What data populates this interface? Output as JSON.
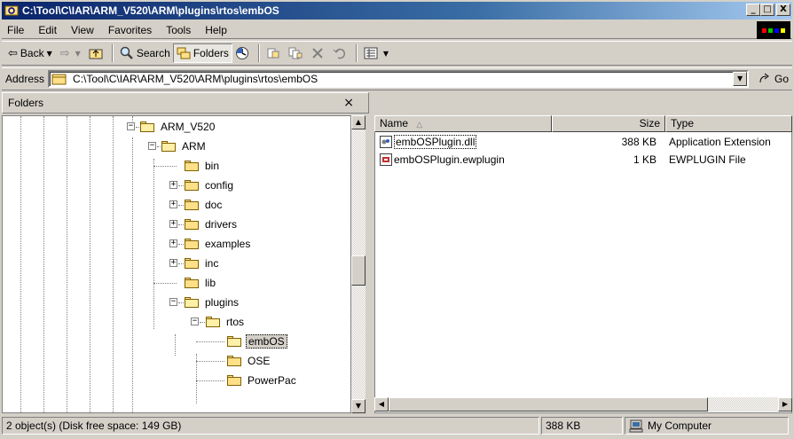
{
  "window": {
    "title": "C:\\Tool\\C\\IAR\\ARM_V520\\ARM\\plugins\\rtos\\embOS",
    "minimize": "_",
    "maximize": "□",
    "close": "X"
  },
  "menu": [
    "File",
    "Edit",
    "View",
    "Favorites",
    "Tools",
    "Help"
  ],
  "toolbar": {
    "back": "Back",
    "search": "Search",
    "folders": "Folders"
  },
  "address": {
    "label": "Address",
    "value": "C:\\Tool\\C\\IAR\\ARM_V520\\ARM\\plugins\\rtos\\embOS",
    "go": "Go"
  },
  "folders_pane": {
    "title": "Folders",
    "close": "×",
    "items": [
      {
        "label": "ARM_V520",
        "expander": "−"
      },
      {
        "label": "ARM",
        "expander": "−"
      },
      {
        "label": "bin",
        "expander": ""
      },
      {
        "label": "config",
        "expander": "+"
      },
      {
        "label": "doc",
        "expander": "+"
      },
      {
        "label": "drivers",
        "expander": "+"
      },
      {
        "label": "examples",
        "expander": "+"
      },
      {
        "label": "inc",
        "expander": "+"
      },
      {
        "label": "lib",
        "expander": ""
      },
      {
        "label": "plugins",
        "expander": "−"
      },
      {
        "label": "rtos",
        "expander": "−"
      },
      {
        "label": "embOS",
        "expander": ""
      },
      {
        "label": "OSE",
        "expander": ""
      },
      {
        "label": "PowerPac",
        "expander": ""
      }
    ]
  },
  "file_list": {
    "columns": {
      "name": "Name",
      "size": "Size",
      "type": "Type"
    },
    "files": [
      {
        "name": "embOSPlugin.dll",
        "size": "388 KB",
        "type": "Application Extension"
      },
      {
        "name": "embOSPlugin.ewplugin",
        "size": "1 KB",
        "type": "EWPLUGIN File"
      }
    ]
  },
  "status": {
    "objects": "2 object(s) (Disk free space: 149 GB)",
    "size": "388 KB",
    "zone": "My Computer"
  },
  "colors": {
    "title_start": "#0a246a",
    "title_end": "#a6caf0",
    "face": "#d4d0c8"
  }
}
